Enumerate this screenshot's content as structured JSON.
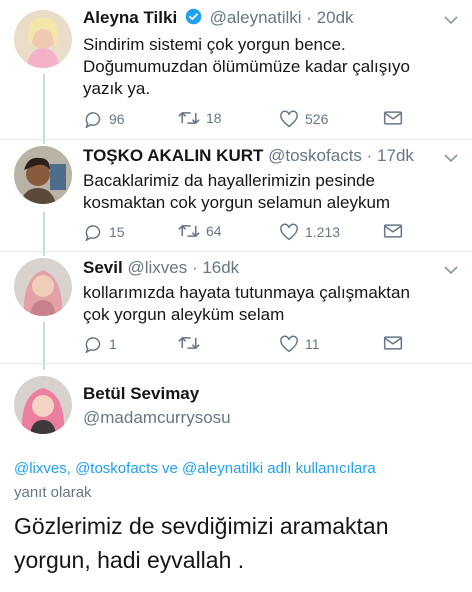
{
  "tweets": [
    {
      "name": "Aleyna Tilki",
      "verified": true,
      "handle": "@aleynatilki",
      "time": "· 20dk",
      "lines": [
        "Sindirim sistemi çok yorgun bence.",
        "Doğumumuzdan ölümümüze kadar çalışıyo",
        "yazık ya."
      ],
      "replies": "96",
      "retweets": "18",
      "likes": "526"
    },
    {
      "name": "TOŞKO AKALIN KURT",
      "verified": false,
      "handle": "@toskofacts",
      "time": "· 17dk",
      "lines": [
        "Bacaklarimiz da hayallerimizin pesinde",
        "kosmaktan cok yorgun selamun aleykum"
      ],
      "replies": "15",
      "retweets": "64",
      "likes": "1.213"
    },
    {
      "name": "Sevil",
      "verified": false,
      "handle": "@lixves",
      "time": "· 16dk",
      "lines": [
        "kollarımızda hayata tutunmaya çalışmaktan",
        "çok yorgun aleyküm selam"
      ],
      "replies": "1",
      "retweets": "",
      "likes": "11"
    }
  ],
  "reply": {
    "name": "Betül Sevimay",
    "handle": "@madamcurrysosu",
    "mentions": "@lixves, @toskofacts ve @aleynatilki adlı kullanıcılara",
    "replying_label": "yanıt olarak",
    "text_line1": "Gözlerimiz de sevdiğimizi aramaktan",
    "text_line2": "yorgun, hadi eyvallah ."
  },
  "colors": {
    "link": "#1da1f2",
    "muted": "#657786",
    "verified": "#1da1f2",
    "line": "#ccd6dd"
  },
  "icons": [
    "reply-icon",
    "retweet-icon",
    "like-icon",
    "direct-message-icon",
    "chevron-down-icon",
    "verified-icon"
  ]
}
